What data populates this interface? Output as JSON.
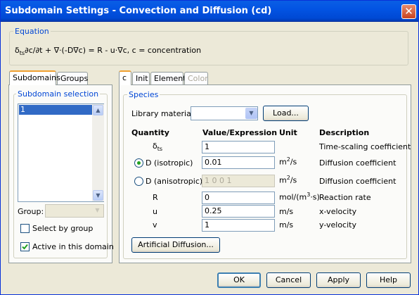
{
  "window": {
    "title": "Subdomain Settings - Convection and Diffusion (cd)",
    "close_glyph": "✕"
  },
  "equation": {
    "group_label": "Equation",
    "prefix": "δ",
    "prefix_sub": "ts",
    "text": "∂c/∂t + ∇·(-D∇c) = R - u·∇c, c = concentration"
  },
  "left_tabs": [
    "Subdomains",
    "Groups"
  ],
  "subdomain_selection": {
    "label": "Subdomain selection",
    "items": [
      "1"
    ],
    "group_label": "Group:",
    "select_by_group": "Select by group",
    "active_in_domain": "Active in this domain"
  },
  "right_tabs": [
    "c",
    "Init",
    "Element",
    "Color"
  ],
  "species": {
    "label": "Species",
    "library_label": "Library material:",
    "library_value": "",
    "load_button": "Load...",
    "headers": {
      "quantity": "Quantity",
      "value": "Value/Expression",
      "unit": "Unit",
      "description": "Description"
    },
    "rows": [
      {
        "quantity": "δ",
        "quantity_sub": "ts",
        "value": "1",
        "unit": "",
        "description": "Time-scaling coefficient"
      },
      {
        "quantity": "D (isotropic)",
        "value": "0.01",
        "unit": "m",
        "unit_sup": "2",
        "unit_tail": "/s",
        "description": "Diffusion coefficient",
        "selected": true
      },
      {
        "quantity": "D (anisotropic)",
        "value": "1 0 0 1",
        "unit": "m",
        "unit_sup": "2",
        "unit_tail": "/s",
        "description": "Diffusion coefficient",
        "selected": false
      },
      {
        "quantity": "R",
        "value": "0",
        "unit": "mol/(m",
        "unit_sup": "3",
        "unit_tail": "·s)",
        "description": "Reaction rate"
      },
      {
        "quantity": "u",
        "value": "0.25",
        "unit": "m/s",
        "description": "x-velocity"
      },
      {
        "quantity": "v",
        "value": "1",
        "unit": "m/s",
        "description": "y-velocity"
      }
    ],
    "artificial_diffusion_button": "Artificial Diffusion..."
  },
  "footer": {
    "ok": "OK",
    "cancel": "Cancel",
    "apply": "Apply",
    "help": "Help"
  },
  "colors": {
    "title_bar": "#0054e3",
    "group_label": "#0046d5",
    "selection": "#316ac5",
    "check": "#21a121"
  }
}
